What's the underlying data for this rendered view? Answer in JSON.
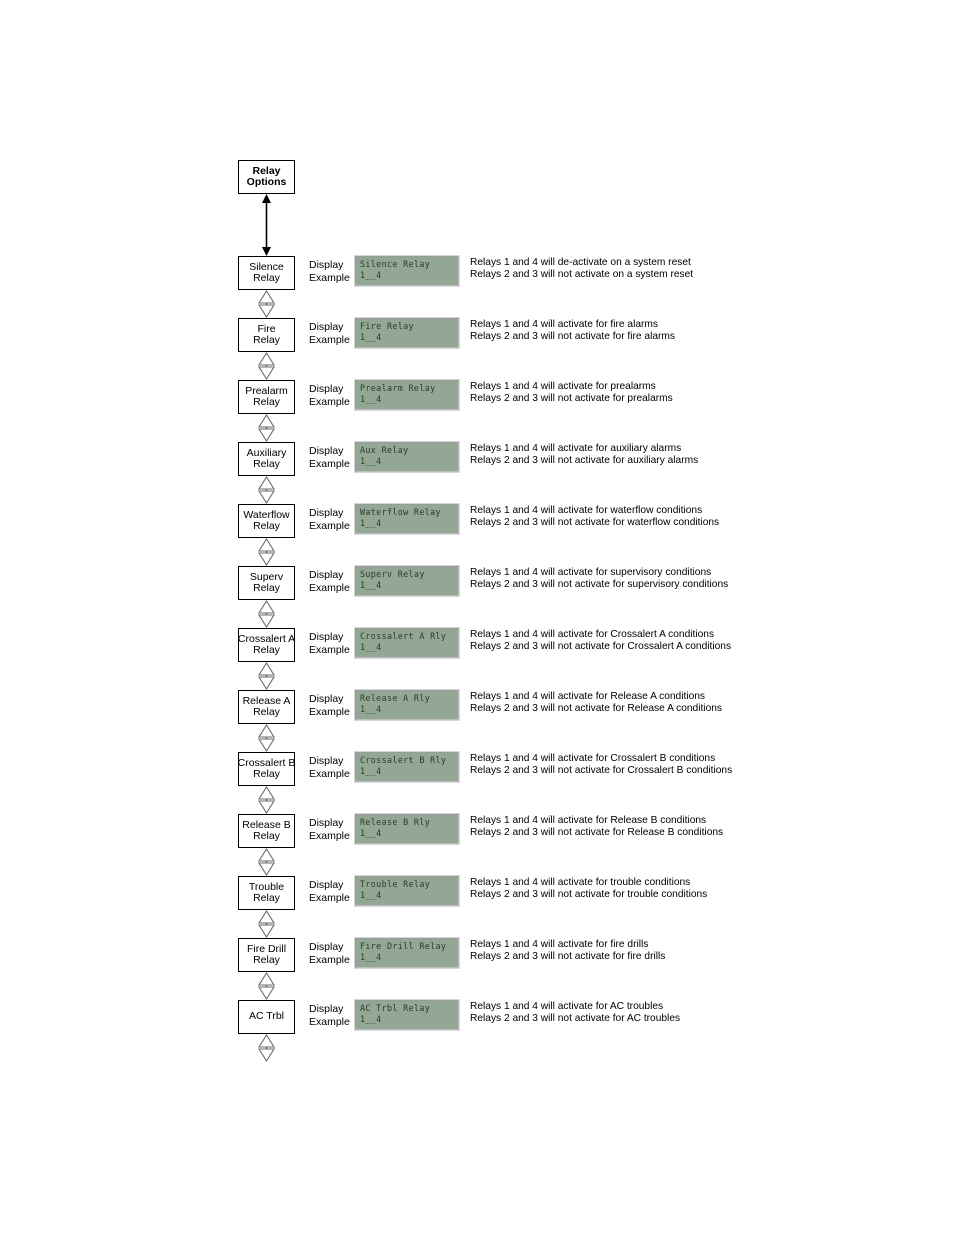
{
  "diagram": {
    "title_node": {
      "lines": [
        "Relay",
        "Options"
      ],
      "connector": "solid-double-arrow"
    },
    "labels": {
      "display_example_line1": "Display",
      "display_example_line2": "Example"
    },
    "colors": {
      "lcd_background": "#93a894",
      "lcd_text": "#2d3a33",
      "lcd_bezel": "#9a9a9a",
      "box_border": "#000000",
      "page_background": "#ffffff"
    },
    "items": [
      {
        "box": [
          "Silence",
          "Relay"
        ],
        "lcd_line1": "Silence Relay",
        "lcd_line2": "1__4",
        "desc_line1": "Relays 1 and 4 will de-activate on a system reset",
        "desc_line2": "Relays 2 and 3 will not activate on a system reset"
      },
      {
        "box": [
          "Fire",
          "Relay"
        ],
        "lcd_line1": "Fire Relay",
        "lcd_line2": "1__4",
        "desc_line1": "Relays 1 and 4 will activate for fire alarms",
        "desc_line2": "Relays 2 and 3 will not activate for fire alarms"
      },
      {
        "box": [
          "Prealarm",
          "Relay"
        ],
        "lcd_line1": "Prealarm Relay",
        "lcd_line2": "1__4",
        "desc_line1": "Relays 1 and 4 will activate for prealarms",
        "desc_line2": "Relays 2 and 3 will not activate for prealarms"
      },
      {
        "box": [
          "Auxiliary",
          "Relay"
        ],
        "lcd_line1": "Aux Relay",
        "lcd_line2": "1__4",
        "desc_line1": "Relays 1 and 4 will activate for auxiliary alarms",
        "desc_line2": "Relays 2 and 3 will not activate for auxiliary alarms"
      },
      {
        "box": [
          "Waterflow",
          "Relay"
        ],
        "lcd_line1": "Waterflow Relay",
        "lcd_line2": "1__4",
        "desc_line1": "Relays 1 and 4 will activate for waterflow conditions",
        "desc_line2": "Relays 2 and 3 will not activate for waterflow conditions"
      },
      {
        "box": [
          "Superv",
          "Relay"
        ],
        "lcd_line1": "Superv Relay",
        "lcd_line2": "1__4",
        "desc_line1": "Relays 1 and 4 will activate for supervisory conditions",
        "desc_line2": "Relays 2 and 3 will not activate for supervisory conditions"
      },
      {
        "box": [
          "Crossalert A",
          "Relay"
        ],
        "lcd_line1": "Crossalert A Rly",
        "lcd_line2": "1__4",
        "desc_line1": "Relays 1 and 4 will activate for Crossalert A conditions",
        "desc_line2": "Relays 2 and 3 will not activate for Crossalert A conditions"
      },
      {
        "box": [
          "Release A",
          "Relay"
        ],
        "lcd_line1": "Release A Rly",
        "lcd_line2": "1__4",
        "desc_line1": "Relays 1 and 4 will activate for Release A conditions",
        "desc_line2": "Relays 2 and 3 will not activate for Release A conditions"
      },
      {
        "box": [
          "Crossalert B",
          "Relay"
        ],
        "lcd_line1": "Crossalert B Rly",
        "lcd_line2": "1__4",
        "desc_line1": "Relays 1 and 4 will activate for Crossalert B conditions",
        "desc_line2": "Relays 2 and 3 will not activate for Crossalert B conditions"
      },
      {
        "box": [
          "Release B",
          "Relay"
        ],
        "lcd_line1": "Release B Rly",
        "lcd_line2": "1__4",
        "desc_line1": "Relays 1 and 4 will activate for Release B conditions",
        "desc_line2": "Relays 2 and 3 will not activate for Release B conditions"
      },
      {
        "box": [
          "Trouble",
          "Relay"
        ],
        "lcd_line1": "Trouble Relay",
        "lcd_line2": "1__4",
        "desc_line1": "Relays 1 and 4 will activate for trouble conditions",
        "desc_line2": "Relays 2 and 3 will not activate for trouble conditions"
      },
      {
        "box": [
          "Fire Drill",
          "Relay"
        ],
        "lcd_line1": "Fire Drill Relay",
        "lcd_line2": "1__4",
        "desc_line1": "Relays 1 and 4 will activate for fire drills",
        "desc_line2": "Relays 2 and 3 will not activate for fire drills"
      },
      {
        "box": [
          "AC Trbl"
        ],
        "lcd_line1": "AC Trbl Relay",
        "lcd_line2": "1__4",
        "desc_line1": "Relays 1 and 4 will activate for AC troubles",
        "desc_line2": "Relays 2 and 3 will not activate for AC troubles"
      }
    ]
  }
}
